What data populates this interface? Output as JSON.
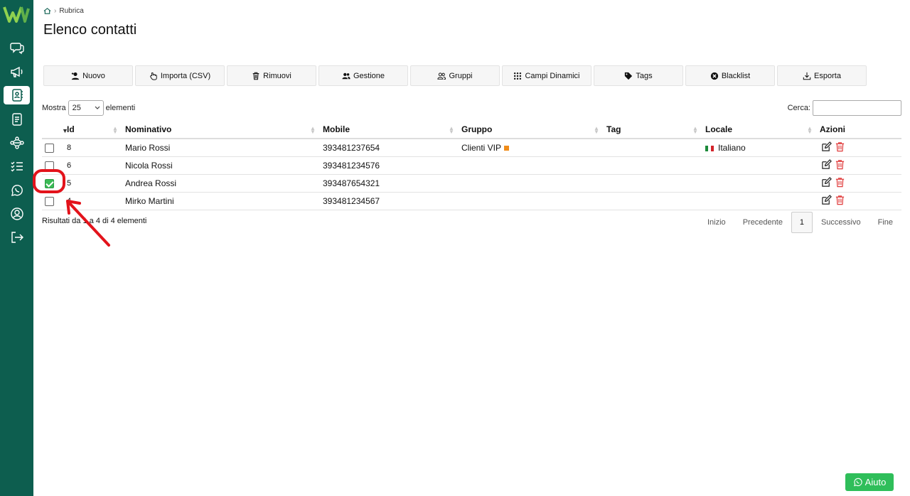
{
  "breadcrumb": {
    "current": "Rubrica"
  },
  "page_title": "Elenco contatti",
  "toolbar": [
    {
      "label": "Nuovo",
      "icon": "add-user-icon"
    },
    {
      "label": "Importa (CSV)",
      "icon": "hand-pointer-icon"
    },
    {
      "label": "Rimuovi",
      "icon": "trash-icon"
    },
    {
      "label": "Gestione",
      "icon": "users-icon"
    },
    {
      "label": "Gruppi",
      "icon": "users-outline-icon"
    },
    {
      "label": "Campi Dinamici",
      "icon": "grid-icon"
    },
    {
      "label": "Tags",
      "icon": "tag-icon"
    },
    {
      "label": "Blacklist",
      "icon": "ban-icon"
    },
    {
      "label": "Esporta",
      "icon": "download-icon"
    }
  ],
  "length": {
    "prefix": "Mostra",
    "value": "25",
    "suffix": "elementi"
  },
  "search": {
    "label": "Cerca:",
    "value": ""
  },
  "table": {
    "headers": [
      "Id",
      "Nominativo",
      "Mobile",
      "Gruppo",
      "Tag",
      "Locale",
      "Azioni"
    ],
    "rows": [
      {
        "checked": false,
        "id": "8",
        "name": "Mario Rossi",
        "mobile": "393481237654",
        "group": "Clienti VIP",
        "tag": "",
        "locale": "Italiano"
      },
      {
        "checked": false,
        "id": "6",
        "name": "Nicola Rossi",
        "mobile": "393481234576",
        "group": "",
        "tag": "",
        "locale": ""
      },
      {
        "checked": true,
        "id": "5",
        "name": "Andrea Rossi",
        "mobile": "393487654321",
        "group": "",
        "tag": "",
        "locale": ""
      },
      {
        "checked": false,
        "id": "4",
        "name": "Mirko Martini",
        "mobile": "393481234567",
        "group": "",
        "tag": "",
        "locale": ""
      }
    ]
  },
  "info": "Risultati da 1 a 4 di 4 elementi",
  "pagination": {
    "first": "Inizio",
    "previous": "Precedente",
    "current": "1",
    "next": "Successivo",
    "last": "Fine"
  },
  "help_button": "Aiuto",
  "colors": {
    "sidebar": "#0d5e4f",
    "accent": "#2fbe5a",
    "group_swatch": "#f08c1a",
    "annotation": "#e3131b"
  }
}
